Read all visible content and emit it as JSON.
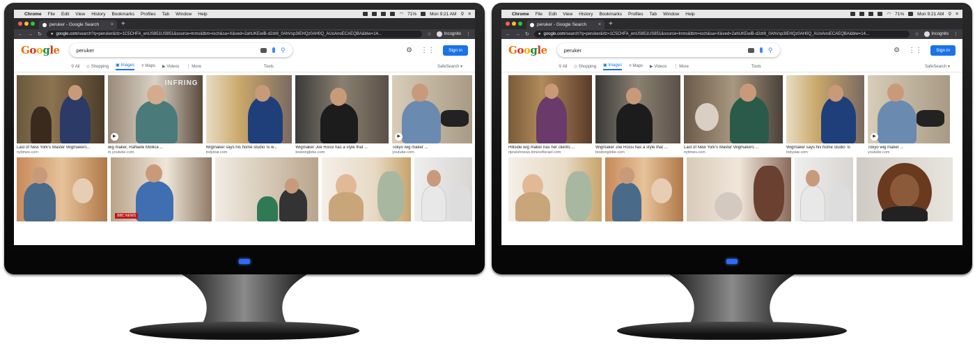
{
  "menubar": {
    "app": "Chrome",
    "items": [
      "File",
      "Edit",
      "View",
      "History",
      "Bookmarks",
      "Profiles",
      "Tab",
      "Window",
      "Help"
    ],
    "battery": "71%",
    "clock": "Mon 9:21 AM"
  },
  "browser": {
    "tab_title": "peruker - Google Search",
    "url_host": "google.com",
    "url_path": "/search?q=peruker&rlz=1C5CHFA_enUS851US851&source=lnms&tbm=isch&sa=X&ved=2ahUKEwiB-d2dr8_0AhVsp3IEHQz0AH0Q_AUoAnoECAEQBA&biw=14...",
    "incognito_label": "Incognito"
  },
  "google": {
    "logo": "Google",
    "query": "peruker",
    "sign_in": "Sign in",
    "nav": {
      "all": "All",
      "shopping": "Shopping",
      "images": "Images",
      "maps": "Maps",
      "videos": "Videos",
      "more": "More",
      "tools": "Tools",
      "safesearch": "SafeSearch ▾"
    }
  },
  "colors": {
    "accent": "#1a73e8",
    "bezel": "#111111",
    "power_led": "#2d6bff"
  },
  "left_results": {
    "row1": [
      {
        "caption": "Last of New York's Master Wigmakers...",
        "source": "nytimes.com"
      },
      {
        "caption": "wig maker, Raffaele Mollica ...",
        "source": "m.youtube.com"
      },
      {
        "caption": "Wigmaker says his home studio 'is w...",
        "source": "indystar.com"
      },
      {
        "caption": "Wigmaker Joe Rossi has a style that ...",
        "source": "bostonglobe.com"
      },
      {
        "caption": "Tokyo wig maker ...",
        "source": "youtube.com"
      }
    ],
    "row2_badge": "BBC NEWS",
    "watermark": "INFRING"
  },
  "right_results": {
    "row1": [
      {
        "caption": "Hillside wig maker has her clients ...",
        "source": "rijewishnews.timesofisrael.com"
      },
      {
        "caption": "Wigmaker Joe Rossi has a style that ...",
        "source": "bostonglobe.com"
      },
      {
        "caption": "Last of New York's Master Wigmakers ...",
        "source": "nytimes.com"
      },
      {
        "caption": "Wigmaker says his home studio 'is",
        "source": "indystar.com"
      },
      {
        "caption": "Tokyo wig maker ...",
        "source": "youtube.com"
      }
    ]
  }
}
